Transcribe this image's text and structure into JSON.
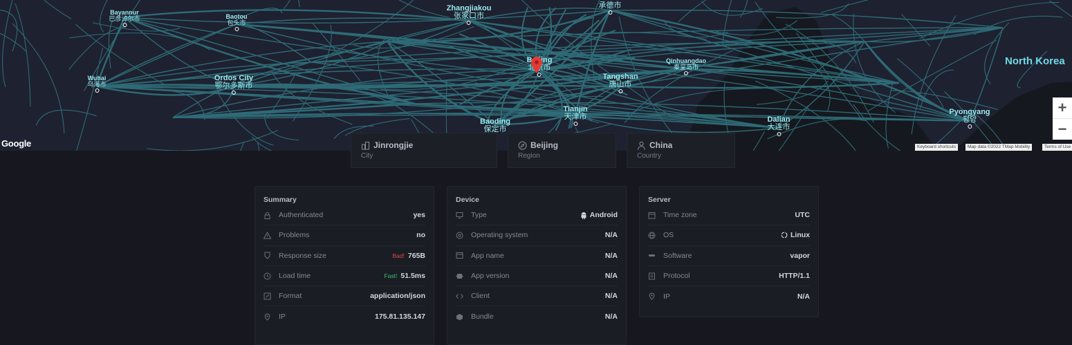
{
  "map": {
    "cities": [
      {
        "en": "Bayannur",
        "zh": "巴彦淖尔市"
      },
      {
        "en": "Baotou",
        "zh": "包头市"
      },
      {
        "en": "Zhangjiakou",
        "zh": "张家口市"
      },
      {
        "en": "",
        "zh": "承德市"
      },
      {
        "en": "Wuhai",
        "zh": "乌海市"
      },
      {
        "en": "Ordos City",
        "zh": "鄂尔多斯市"
      },
      {
        "en": "Beijing",
        "zh": "北京市"
      },
      {
        "en": "Tangshan",
        "zh": "唐山市"
      },
      {
        "en": "Qinhuangdao",
        "zh": "秦皇岛市"
      },
      {
        "en": "Tianjin",
        "zh": "天津市"
      },
      {
        "en": "Baoding",
        "zh": "保定市"
      },
      {
        "en": "Dalian",
        "zh": "大连市"
      },
      {
        "en": "Pyongyang",
        "zh": "평양"
      }
    ],
    "country_label": "North Korea",
    "logo": "Google",
    "attribution": [
      "Keyboard shortcuts",
      "Map data ©2022 TMap Mobility",
      "Terms of Use"
    ],
    "zoom_in": "+",
    "zoom_out": "−",
    "pin_icon": "map-pin-icon",
    "road_color": "#2f6f7a"
  },
  "location": [
    {
      "name": "Jinrongjie",
      "sub": "City",
      "icon": "building-icon"
    },
    {
      "name": "Beijing",
      "sub": "Region",
      "icon": "compass-icon"
    },
    {
      "name": "China",
      "sub": "Country",
      "icon": "person-icon"
    }
  ],
  "summary": {
    "title": "Summary",
    "rows": [
      {
        "label": "Authenticated",
        "value": "yes",
        "icon": "lock-icon"
      },
      {
        "label": "Problems",
        "value": "no",
        "icon": "warning-icon"
      },
      {
        "label": "Response size",
        "value": "765B",
        "badge": "Bad!",
        "icon": "badge-icon"
      },
      {
        "label": "Load time",
        "value": "51.5ms",
        "badge": "Fast!",
        "icon": "clock-icon"
      },
      {
        "label": "Format",
        "value": "application/json",
        "icon": "edit-icon"
      },
      {
        "label": "IP",
        "value": "175.81.135.147",
        "icon": "location-icon"
      }
    ]
  },
  "device": {
    "title": "Device",
    "rows": [
      {
        "label": "Type",
        "value": "Android",
        "icon": "monitor-icon"
      },
      {
        "label": "Operating system",
        "value": "N/A",
        "icon": "os-icon"
      },
      {
        "label": "App name",
        "value": "N/A",
        "icon": "window-icon"
      },
      {
        "label": "App version",
        "value": "N/A",
        "icon": "puzzle-icon"
      },
      {
        "label": "Client",
        "value": "N/A",
        "icon": "code-icon"
      },
      {
        "label": "Bundle",
        "value": "N/A",
        "icon": "box-icon"
      }
    ]
  },
  "server": {
    "title": "Server",
    "rows": [
      {
        "label": "Time zone",
        "value": "UTC",
        "icon": "calendar-icon"
      },
      {
        "label": "OS",
        "value": "Linux",
        "icon": "globe-icon"
      },
      {
        "label": "Software",
        "value": "vapor",
        "icon": "software-icon"
      },
      {
        "label": "Protocol",
        "value": "HTTP/1.1",
        "icon": "protocol-icon"
      },
      {
        "label": "IP",
        "value": "N/A",
        "icon": "location-icon"
      }
    ]
  }
}
